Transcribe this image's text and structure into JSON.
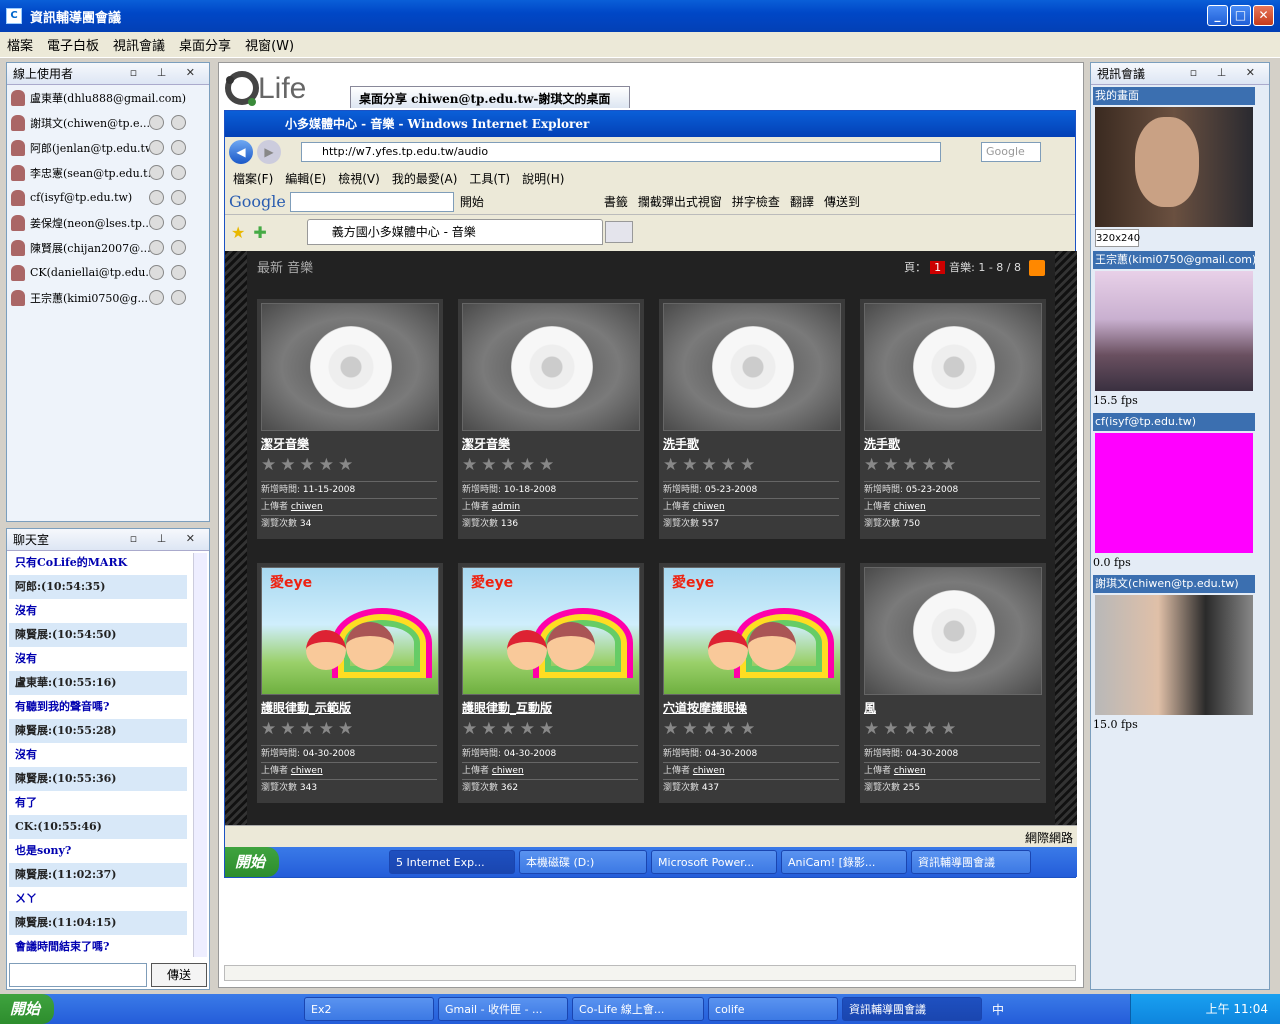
{
  "window": {
    "title": "資訊輔導團會議",
    "icon_text": "C"
  },
  "menu": [
    "檔案",
    "電子白板",
    "視訊會議",
    "桌面分享",
    "視窗(W)"
  ],
  "users_panel": {
    "title": "線上使用者",
    "users": [
      "盧東華(dhlu888@gmail.com)",
      "謝琪文(chiwen@tp.e...",
      "阿郎(jenlan@tp.edu.tw)",
      "李忠憲(sean@tp.edu.t...",
      "cf(isyf@tp.edu.tw)",
      "姜保煌(neon@lses.tp....",
      "陳賢展(chijan2007@...",
      "CK(daniellai@tp.edu.t...",
      "王宗蕙(kimi0750@g..."
    ]
  },
  "chat_panel": {
    "title": "聊天室",
    "lines": [
      {
        "t": "只有CoLife的MARK",
        "k": "msg"
      },
      {
        "t": "阿郎:(10:54:35)",
        "k": "who"
      },
      {
        "t": "沒有",
        "k": "msg"
      },
      {
        "t": "陳賢展:(10:54:50)",
        "k": "who"
      },
      {
        "t": "沒有",
        "k": "msg"
      },
      {
        "t": "盧東華:(10:55:16)",
        "k": "who"
      },
      {
        "t": "有聽到我的聲音嗎?",
        "k": "msg"
      },
      {
        "t": "陳賢展:(10:55:28)",
        "k": "who"
      },
      {
        "t": "沒有",
        "k": "msg"
      },
      {
        "t": "陳賢展:(10:55:36)",
        "k": "who"
      },
      {
        "t": "有了",
        "k": "msg"
      },
      {
        "t": "CK:(10:55:46)",
        "k": "who"
      },
      {
        "t": "也是sony?",
        "k": "msg"
      },
      {
        "t": "陳賢展:(11:02:37)",
        "k": "who"
      },
      {
        "t": "ㄨㄚ",
        "k": "msg"
      },
      {
        "t": "陳賢展:(11:04:15)",
        "k": "who"
      },
      {
        "t": "會議時間結束了嗎?",
        "k": "msg"
      }
    ],
    "send_label": "傳送",
    "input_value": ""
  },
  "colife": {
    "logo_text": "Co Life",
    "share_tab": "桌面分享 chiwen@tp.edu.tw-謝琪文的桌面"
  },
  "ie": {
    "title": "小多媒體中心 - 音樂 - Windows Internet Explorer",
    "address": "http://w7.yfes.tp.edu.tw/audio",
    "search_placeholder": "Google",
    "menu": [
      "檔案(F)",
      "編輯(E)",
      "檢視(V)",
      "我的最愛(A)",
      "工具(T)",
      "說明(H)"
    ],
    "google_label": "Google",
    "google_items": [
      "開始",
      "書籤",
      "攔截彈出式視窗",
      "拼字檢查",
      "翻譯",
      "傳送到"
    ],
    "tab": "義方國小多媒體中心 - 音樂",
    "status_zone": "網際網路"
  },
  "page": {
    "section": "最新 音樂",
    "page_label": "頁：",
    "page_num": "1",
    "count": "音樂: 1 - 8 / 8",
    "labels": {
      "added": "新增時間:",
      "uploader": "上傳者",
      "views": "瀏覽次數"
    },
    "items": [
      {
        "title": "潔牙音樂",
        "date": "11-15-2008",
        "uploader": "chiwen",
        "views": "34",
        "art": false
      },
      {
        "title": "潔牙音樂",
        "date": "10-18-2008",
        "uploader": "admin",
        "views": "136",
        "art": false
      },
      {
        "title": "洗手歌",
        "date": "05-23-2008",
        "uploader": "chiwen",
        "views": "557",
        "art": false
      },
      {
        "title": "洗手歌",
        "date": "05-23-2008",
        "uploader": "chiwen",
        "views": "750",
        "art": false
      },
      {
        "title": "護眼律動_示範版",
        "date": "04-30-2008",
        "uploader": "chiwen",
        "views": "343",
        "art": true
      },
      {
        "title": "護眼律動_互動版",
        "date": "04-30-2008",
        "uploader": "chiwen",
        "views": "362",
        "art": true
      },
      {
        "title": "穴道按摩護眼操",
        "date": "04-30-2008",
        "uploader": "chiwen",
        "views": "437",
        "art": true
      },
      {
        "title": "風",
        "date": "04-30-2008",
        "uploader": "chiwen",
        "views": "255",
        "art": false
      }
    ],
    "art_text": "愛eye"
  },
  "inner_taskbar": {
    "start": "開始",
    "items": [
      "5 Internet Exp...",
      "本機磁碟 (D:)",
      "Microsoft Power...",
      "AniCam! [錄影...",
      "資訊輔導團會議"
    ]
  },
  "video_panel": {
    "title": "視訊會議",
    "my_view": "我的畫面",
    "resolution": "320x240",
    "feeds": [
      {
        "name": "王宗蕙(kimi0750@gmail.com)",
        "fps": "15.5 fps"
      },
      {
        "name": "cf(isyf@tp.edu.tw)",
        "fps": "0.0 fps"
      },
      {
        "name": "謝琪文(chiwen@tp.edu.tw)",
        "fps": "15.0 fps"
      }
    ]
  },
  "taskbar": {
    "start": "開始",
    "items": [
      "Ex2",
      "Gmail - 收件匣 - ...",
      "Co-Life 線上會...",
      "colife",
      "資訊輔導團會議"
    ],
    "ime": "中",
    "clock": "上午 11:04"
  }
}
